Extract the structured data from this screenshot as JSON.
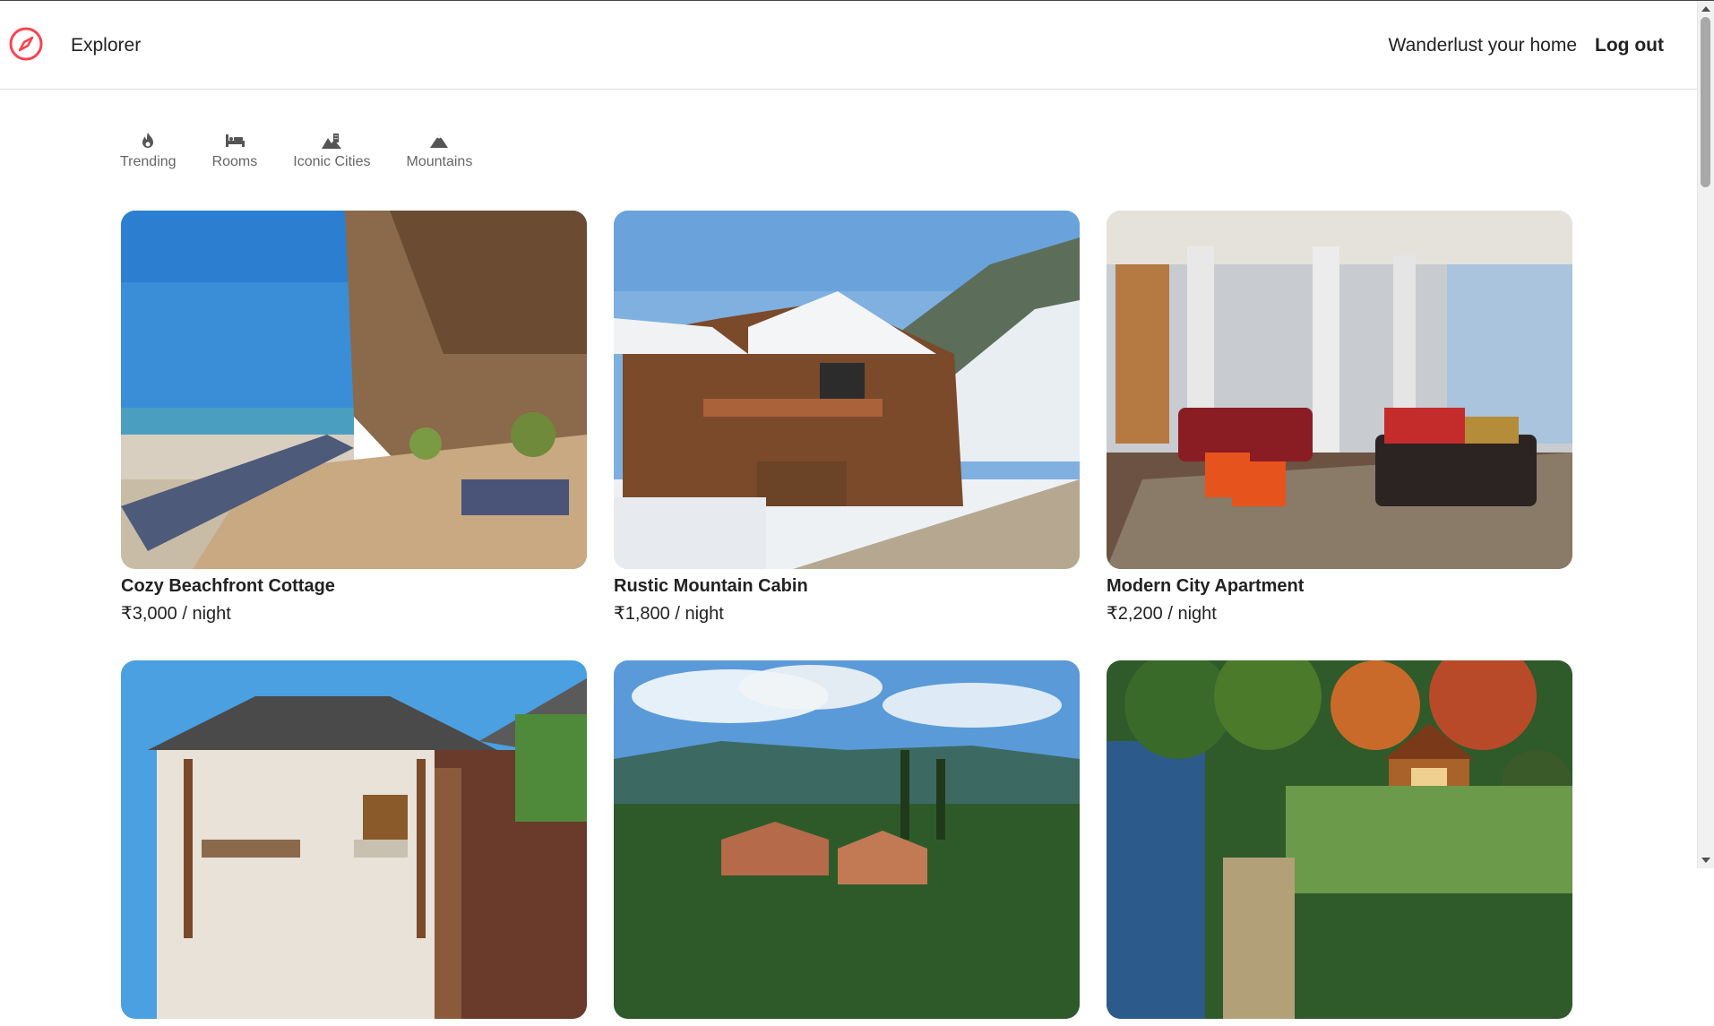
{
  "nav": {
    "brand": "Explorer",
    "links": [
      "Wanderlust your home",
      "Log out"
    ],
    "accent": "#fe424d"
  },
  "filters": [
    {
      "label": "Trending",
      "icon": "fire-icon"
    },
    {
      "label": "Rooms",
      "icon": "bed-icon"
    },
    {
      "label": "Iconic Cities",
      "icon": "city-icon"
    },
    {
      "label": "Mountains",
      "icon": "mountain-icon"
    }
  ],
  "listings": [
    {
      "title": "Cozy Beachfront Cottage",
      "price": "₹3,000 / night"
    },
    {
      "title": "Rustic Mountain Cabin",
      "price": "₹1,800 / night"
    },
    {
      "title": "Modern City Apartment",
      "price": "₹2,200 / night"
    },
    {
      "title": "",
      "price": ""
    },
    {
      "title": "",
      "price": ""
    },
    {
      "title": "",
      "price": ""
    }
  ]
}
